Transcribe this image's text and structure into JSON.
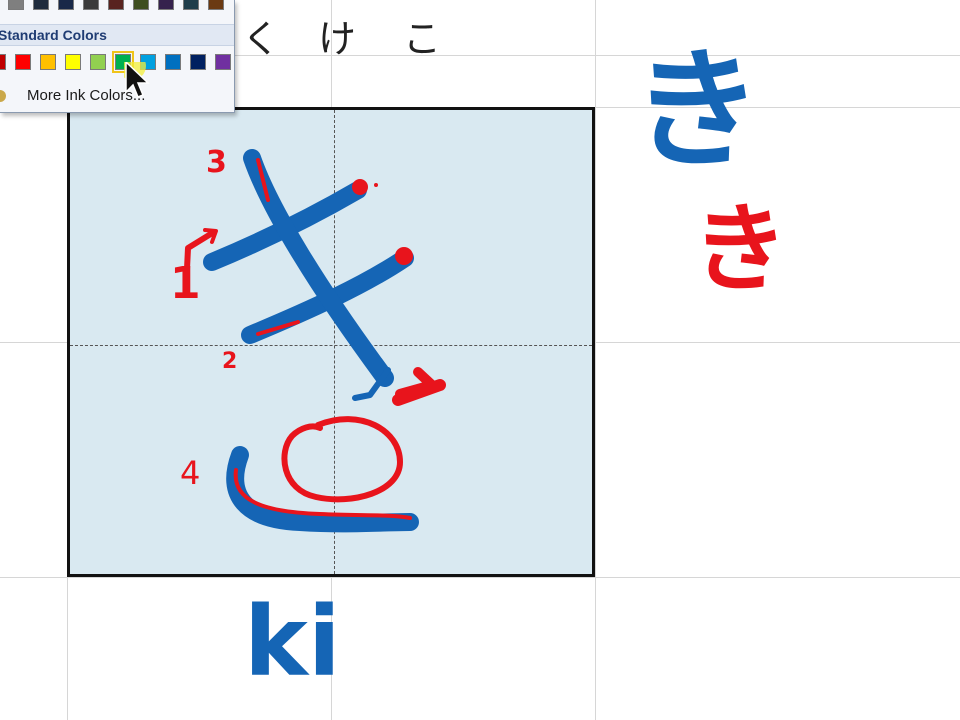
{
  "header": {
    "kana": [
      "く",
      "け",
      "こ"
    ]
  },
  "character": {
    "kana": "き",
    "romaji": "ki",
    "stroke_numbers": [
      "1",
      "2",
      "3",
      "4"
    ]
  },
  "color_menu": {
    "section_title": "Standard Colors",
    "more_colors_label": "More Ink Colors...",
    "theme_row_colors": [
      "#7f7f7f",
      "#1f2b3c",
      "#182848",
      "#3a3a3a",
      "#58231f",
      "#3e4e1f",
      "#35224d",
      "#1f3d4a",
      "#6b3a12"
    ],
    "standard_colors": [
      "#c00000",
      "#ff0000",
      "#ffc000",
      "#ffff00",
      "#92d050",
      "#00b050",
      "#00a0e0",
      "#0070c0",
      "#002060",
      "#7030a0"
    ],
    "selected_color": "#00b050"
  },
  "colors": {
    "blue_ink": "#1565b5",
    "red_ink": "#e8141c",
    "box_fill": "#d9e9f1"
  }
}
